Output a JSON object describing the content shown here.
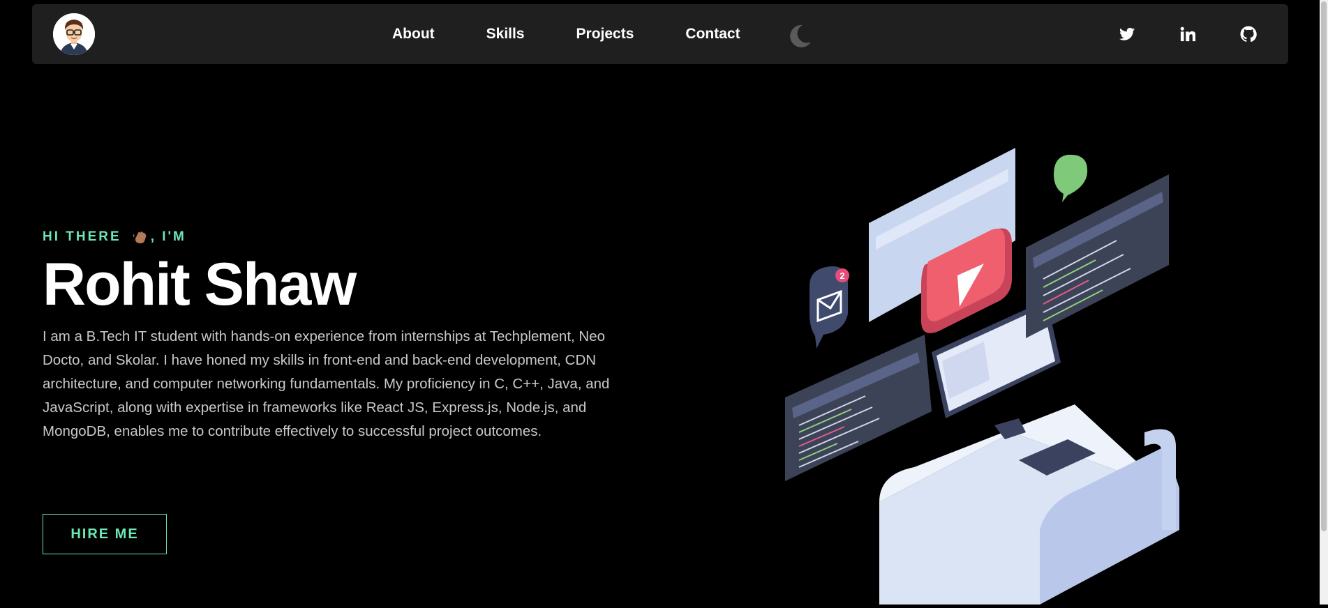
{
  "nav": {
    "links": [
      {
        "label": "About"
      },
      {
        "label": "Skills"
      },
      {
        "label": "Projects"
      },
      {
        "label": "Contact"
      }
    ],
    "theme_toggle_icon": "moon-icon",
    "socials": [
      {
        "icon": "twitter-icon"
      },
      {
        "icon": "linkedin-icon"
      },
      {
        "icon": "github-icon"
      }
    ]
  },
  "hero": {
    "greeting_prefix": "HI THERE",
    "greeting_suffix": ", I'M",
    "wave_icon": "waving-hand-icon",
    "name": "Rohit Shaw",
    "bio": "I am a B.Tech IT student with hands-on experience from internships at Techplement, Neo Docto, and Skolar. I have honed my skills in front-end and back-end development, CDN architecture, and computer networking fundamentals. My proficiency in C, C++, Java, and JavaScript, along with expertise in frameworks like React JS, Express.js, Node.js, and MongoDB, enables me to contribute effectively to successful project outcomes.",
    "cta_label": "HIRE ME",
    "mail_badge_count": "2"
  },
  "colors": {
    "accent": "#6ee7b7",
    "navbar_bg": "#1f1f1f",
    "page_bg": "#000000"
  }
}
